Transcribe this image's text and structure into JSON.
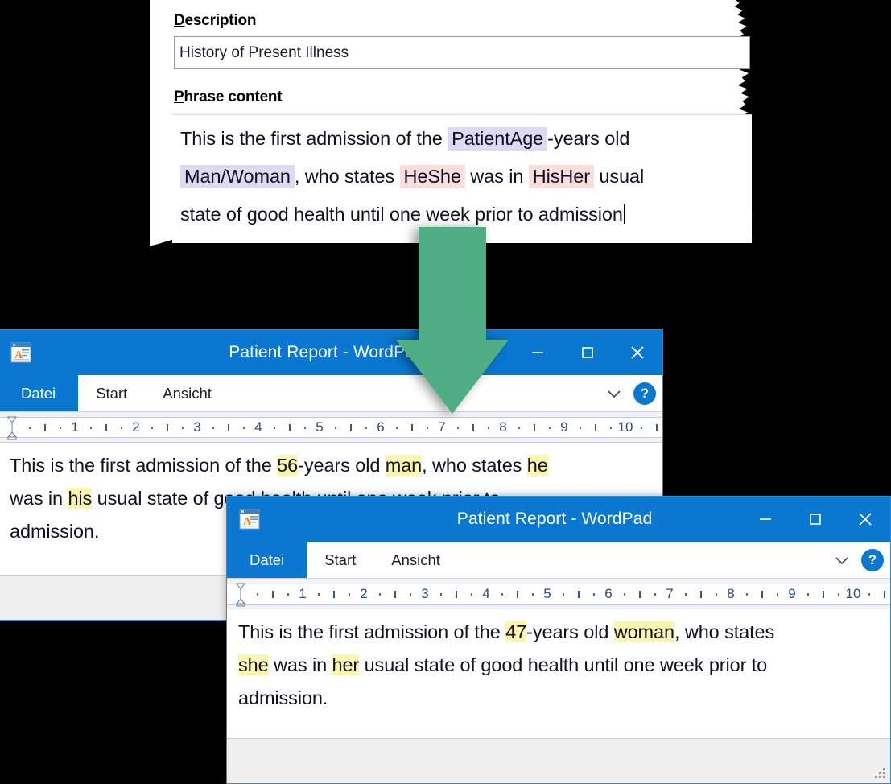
{
  "phrase_editor": {
    "description_label": "Description",
    "description_label_accel": "D",
    "description_label_rest": "escription",
    "description_value": "History of Present Illness",
    "phrase_content_label_accel": "P",
    "phrase_content_label_rest": "hrase content",
    "phrase_content_label": "Phrase content",
    "content_line1_a": "This is the first admission of the ",
    "content_token1": "PatientAge",
    "content_line1_b": "-years old",
    "content_token2": "Man/Woman",
    "content_line2_a": ", who states ",
    "content_token3": "HeShe",
    "content_line2_b": " was in ",
    "content_token4": "HisHer",
    "content_line2_c": " usual",
    "content_line3": "state of good health until one week prior to admission",
    "token_color_placeholder": "#DEDAF2",
    "token_color_pronoun": "#FADEDB"
  },
  "arrow": {
    "name": "down-arrow",
    "color": "#4FAE85"
  },
  "window1": {
    "title": "Patient Report - WordPad",
    "title_visible": "Patient Report - Wo",
    "app_icon": "wordpad-icon",
    "buttons": {
      "minimize": "–",
      "maximize": "□",
      "close": "×"
    },
    "ribbon": {
      "file_tab": "Datei",
      "home_tab": "Start",
      "view_tab": "Ansicht",
      "collapse_icon": "chevron-down-icon",
      "help_label": "?"
    },
    "ruler": {
      "numbers": [
        1,
        2,
        3,
        4,
        5,
        6,
        7,
        8,
        9,
        10
      ]
    },
    "document": {
      "line1_a": "This is the first admission of the ",
      "line1_hl1": "56",
      "line1_b": "-years old ",
      "line1_hl2": "man",
      "line1_c": ", who states ",
      "line1_hl3": "he",
      "line2_a": "was in ",
      "line2_hl1": "his",
      "line2_b": " usual state of good health until one week prior to",
      "line3": "admission.",
      "highlight_color": "#FBF6AE"
    }
  },
  "window2": {
    "title": "Patient Report - WordPad",
    "app_icon": "wordpad-icon",
    "buttons": {
      "minimize": "–",
      "maximize": "□",
      "close": "×"
    },
    "ribbon": {
      "file_tab": "Datei",
      "home_tab": "Start",
      "view_tab": "Ansicht",
      "collapse_icon": "chevron-down-icon",
      "help_label": "?"
    },
    "ruler": {
      "numbers": [
        1,
        2,
        3,
        4,
        5,
        6,
        7,
        8,
        9,
        10
      ]
    },
    "document": {
      "line1_a": "This is the first admission of the ",
      "line1_hl1": "47",
      "line1_b": "-years old ",
      "line1_hl2": "woman",
      "line1_c": ", who states",
      "line2_hl1": "she",
      "line2_a": " was in ",
      "line2_hl2": "her",
      "line2_b": " usual state of good health until one week prior to",
      "line3": "admission.",
      "highlight_color": "#FBF6AE"
    }
  },
  "colors": {
    "titlebar_blue": "#0A78D0",
    "background": "#000000",
    "status_gray": "#EFEFEF"
  }
}
